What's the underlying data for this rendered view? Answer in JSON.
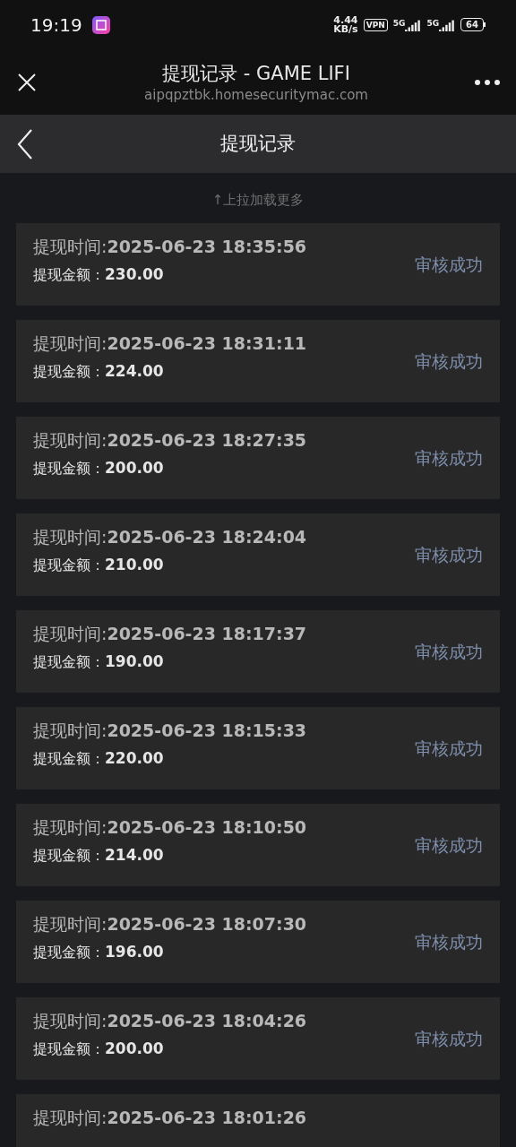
{
  "status_bar": {
    "time": "19:19",
    "net_speed": "4.44",
    "net_unit": "KB/s",
    "vpn": "VPN",
    "sims": [
      "5G",
      "5G"
    ],
    "battery": "64"
  },
  "browser": {
    "title": "提现记录 - GAME LIFI",
    "url": "aipqpztbk.homesecuritymac.com"
  },
  "nav": {
    "title": "提现记录"
  },
  "pull_hint": "↑上拉加载更多",
  "records": [
    {
      "time_label": "提现时间:",
      "time": "2025-06-23 18:35:56",
      "amount_label": "提现金额：",
      "amount": "230.00",
      "status": "审核成功"
    },
    {
      "time_label": "提现时间:",
      "time": "2025-06-23 18:31:11",
      "amount_label": "提现金额：",
      "amount": "224.00",
      "status": "审核成功"
    },
    {
      "time_label": "提现时间:",
      "time": "2025-06-23 18:27:35",
      "amount_label": "提现金额：",
      "amount": "200.00",
      "status": "审核成功"
    },
    {
      "time_label": "提现时间:",
      "time": "2025-06-23 18:24:04",
      "amount_label": "提现金额：",
      "amount": "210.00",
      "status": "审核成功"
    },
    {
      "time_label": "提现时间:",
      "time": "2025-06-23 18:17:37",
      "amount_label": "提现金额：",
      "amount": "190.00",
      "status": "审核成功"
    },
    {
      "time_label": "提现时间:",
      "time": "2025-06-23 18:15:33",
      "amount_label": "提现金额：",
      "amount": "220.00",
      "status": "审核成功"
    },
    {
      "time_label": "提现时间:",
      "time": "2025-06-23 18:10:50",
      "amount_label": "提现金额：",
      "amount": "214.00",
      "status": "审核成功"
    },
    {
      "time_label": "提现时间:",
      "time": "2025-06-23 18:07:30",
      "amount_label": "提现金额：",
      "amount": "196.00",
      "status": "审核成功"
    },
    {
      "time_label": "提现时间:",
      "time": "2025-06-23 18:04:26",
      "amount_label": "提现金额：",
      "amount": "200.00",
      "status": "审核成功"
    },
    {
      "time_label": "提现时间:",
      "time": "2025-06-23 18:01:26"
    }
  ]
}
